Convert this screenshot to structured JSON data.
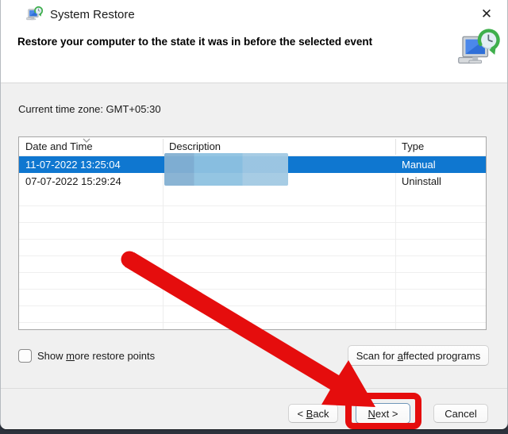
{
  "window": {
    "title": "System Restore",
    "close_glyph": "✕"
  },
  "header": {
    "heading": "Restore your computer to the state it was in before the selected event"
  },
  "body": {
    "timezone": "Current time zone: GMT+05:30"
  },
  "table": {
    "columns": [
      "Date and Time",
      "Description",
      "Type"
    ],
    "sorted_by": "Date and Time",
    "rows": [
      {
        "date_time": "11-07-2022 13:25:04",
        "description": "",
        "type": "Manual",
        "selected": true,
        "description_redacted": true
      },
      {
        "date_time": "07-07-2022 15:29:24",
        "description": "",
        "type": "Uninstall",
        "selected": false,
        "description_redacted": true
      }
    ]
  },
  "checkbox": {
    "pre": "Show ",
    "underlined": "m",
    "post": "ore restore points",
    "checked": false
  },
  "scan_button": {
    "pre": "Scan for ",
    "underlined": "a",
    "post": "ffected programs"
  },
  "footer_buttons": {
    "back": {
      "pre": "< ",
      "underlined": "B",
      "post": "ack"
    },
    "next": {
      "underlined": "N",
      "post": "ext >"
    },
    "cancel": {
      "label": "Cancel"
    }
  },
  "colors": {
    "selection_blue": "#0f77d0",
    "annotation_red": "#e50d0d",
    "redaction_blues": [
      "#84b0d2",
      "#8ec2e1",
      "#a2c9e3"
    ]
  }
}
